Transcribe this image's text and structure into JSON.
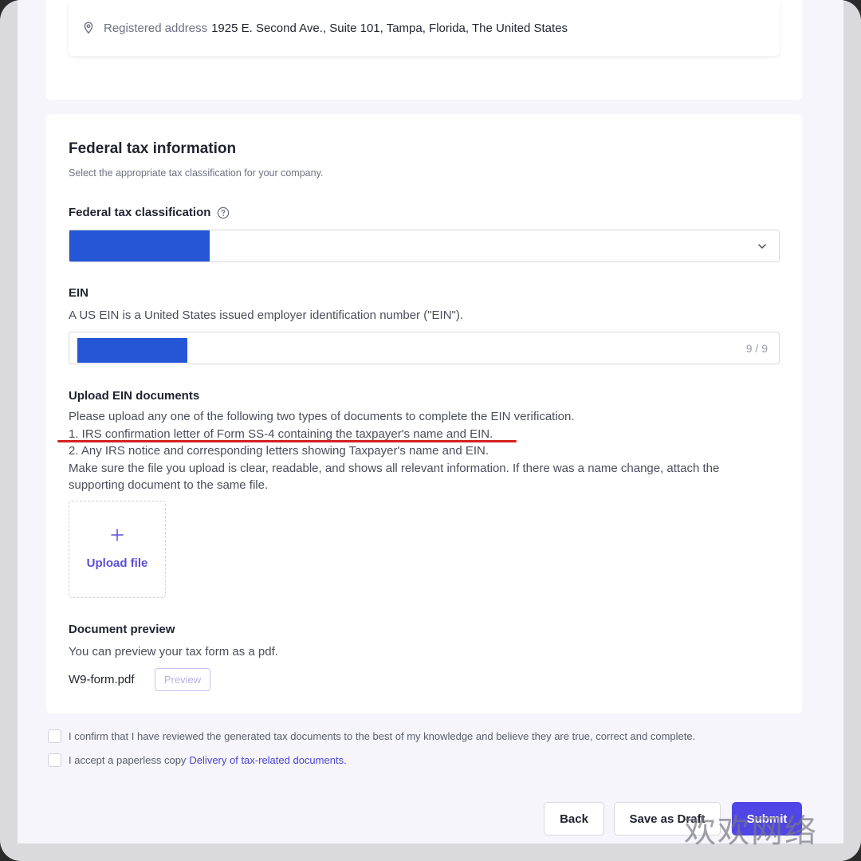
{
  "address": {
    "label": "Registered address",
    "value": "1925 E. Second Ave., Suite 101, Tampa, Florida, The United States"
  },
  "federal_tax": {
    "title": "Federal tax information",
    "subtitle": "Select the appropriate tax classification for your company.",
    "classification_label": "Federal tax classification"
  },
  "ein": {
    "label": "EIN",
    "description": "A US EIN is a United States issued employer identification number (\"EIN\").",
    "counter": "9 / 9"
  },
  "upload_docs": {
    "label": "Upload EIN documents",
    "lines": [
      "Please upload any one of the following two types of documents to complete the EIN verification.",
      "1. IRS confirmation letter of Form SS-4 containing the taxpayer's name and EIN.",
      "2. Any IRS notice and corresponding letters showing Taxpayer's name and EIN.",
      "Make sure the file you upload is clear, readable, and shows all relevant information. If there was a name change, attach the",
      "supporting document to the same file."
    ],
    "upload_label": "Upload file"
  },
  "document_preview": {
    "label": "Document preview",
    "description": "You can preview your tax form as a pdf.",
    "file_name": "W9-form.pdf",
    "preview_button": "Preview"
  },
  "confirmations": {
    "confirm_text": "I confirm that I have reviewed the generated tax documents to the best of my knowledge and believe they are true, correct and complete.",
    "paperless_text": "I accept a paperless copy",
    "paperless_link": "Delivery of tax-related documents."
  },
  "actions": {
    "back": "Back",
    "save_draft": "Save as Draft",
    "submit": "Submit"
  },
  "watermark": "欢欢网络",
  "colors": {
    "accent": "#4f46e5",
    "redaction": "#2456d6",
    "annotation_underline": "#d42020"
  }
}
